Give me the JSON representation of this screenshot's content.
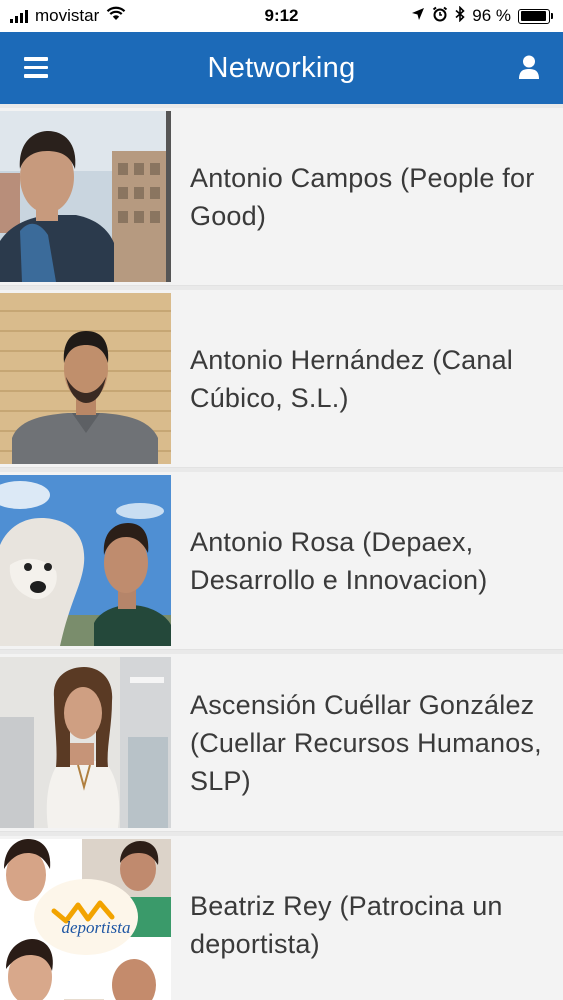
{
  "status_bar": {
    "carrier": "movistar",
    "time": "9:12",
    "battery_percent": "96 %",
    "battery_level": 0.96,
    "icons": [
      "signal-icon",
      "wifi-icon",
      "location-icon",
      "alarm-icon",
      "bluetooth-icon",
      "battery-icon"
    ]
  },
  "header": {
    "title": "Networking",
    "menu_icon": "hamburger-menu-icon",
    "user_icon": "user-profile-icon",
    "background_color": "#1c6ab8"
  },
  "contacts": [
    {
      "name": "Antonio Campos (People for Good)"
    },
    {
      "name": "Antonio Hernández (Canal Cúbico, S.L.)"
    },
    {
      "name": "Antonio Rosa (Depaex, Desarrollo e Innovacion)"
    },
    {
      "name": "Ascensión Cuéllar González (Cuellar Recursos Humanos, SLP)"
    },
    {
      "name": "Beatriz Rey (Patrocina un deportista)"
    },
    {
      "logo_text": "deportista"
    }
  ]
}
